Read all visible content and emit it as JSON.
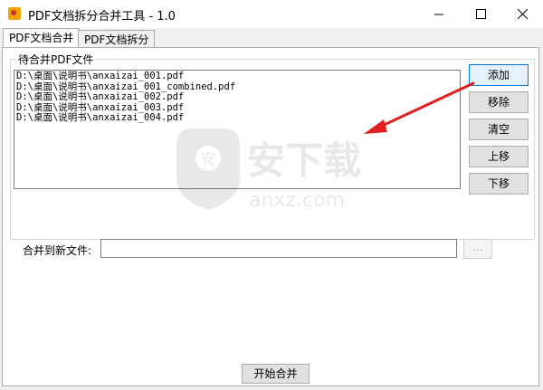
{
  "window": {
    "title": "PDF文档拆分合并工具 - 1.0",
    "minimize_icon": "minimize-icon",
    "maximize_icon": "maximize-icon",
    "close_icon": "close-icon"
  },
  "tabs": [
    {
      "label": "PDF文档合并",
      "active": true
    },
    {
      "label": "PDF文档拆分",
      "active": false
    }
  ],
  "merge_tab": {
    "group_label": "待合并PDF文件",
    "files": [
      "D:\\桌面\\说明书\\anxaizai_001.pdf",
      "D:\\桌面\\说明书\\anxaizai_001_combined.pdf",
      "D:\\桌面\\说明书\\anxaizai_002.pdf",
      "D:\\桌面\\说明书\\anxaizai_003.pdf",
      "D:\\桌面\\说明书\\anxaizai_004.pdf"
    ],
    "buttons": {
      "add": "添加",
      "remove": "移除",
      "clear": "清空",
      "move_up": "上移",
      "move_down": "下移"
    },
    "output_label": "合并到新文件:",
    "output_value": "",
    "browse_label": "...",
    "start_label": "开始合并"
  },
  "watermark": {
    "text_cn": "安下载",
    "text_en": "anxz.com"
  },
  "colors": {
    "arrow": "#e02020",
    "focus_border": "#0078d7"
  }
}
